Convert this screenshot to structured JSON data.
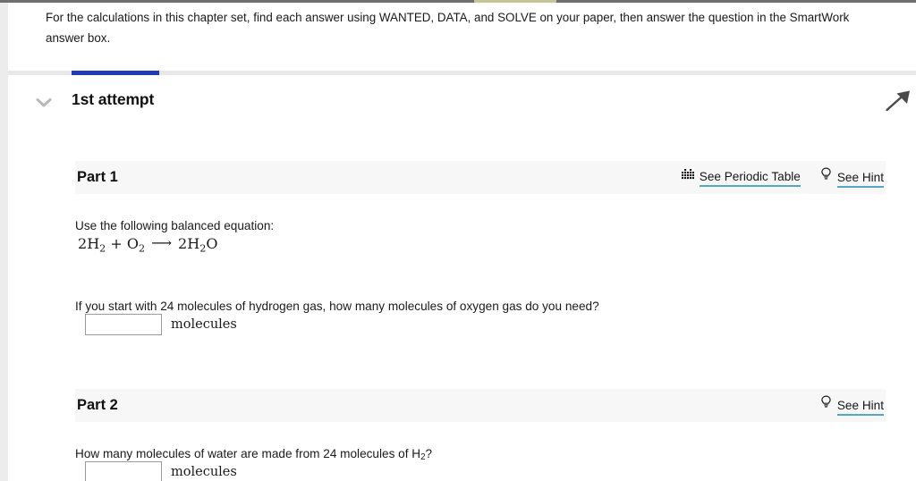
{
  "window": {
    "accent_blue": "#1f3cb4",
    "underline_teal": "#55a7c4",
    "band_bg": "#f7f7f7"
  },
  "intro": {
    "text": "For the calculations in this chapter set, find each answer using WANTED, DATA, and SOLVE on your paper, then answer the question in the SmartWork answer box."
  },
  "attempt": {
    "title": "1st attempt",
    "collapse_icon": "chevron-down-icon",
    "flag_icon": "flag-arrow-icon",
    "progress_percent": 9.7
  },
  "parts": [
    {
      "label": "Part 1",
      "actions": [
        {
          "label": "See Periodic Table",
          "icon": "periodic-table-icon"
        },
        {
          "label": "See Hint",
          "icon": "lightbulb-icon"
        }
      ],
      "prompt": "Use the following balanced equation:",
      "equation": {
        "lhs_coef_1": "2",
        "lhs_sym_1": "H",
        "lhs_sub_1": "2",
        "plus": "+",
        "lhs_sym_2": "O",
        "lhs_sub_2": "2",
        "arrow": "⟶",
        "rhs_coef": "2",
        "rhs_sym_1": "H",
        "rhs_sub_1": "2",
        "rhs_sym_2": "O",
        "plain": "2H2 + O2 ⟶ 2H2O"
      },
      "question": "If you start with 24 molecules of hydrogen gas, how many molecules of oxygen gas do you need?",
      "answer": {
        "value": "",
        "placeholder": "",
        "unit": "molecules"
      }
    },
    {
      "label": "Part 2",
      "actions": [
        {
          "label": "See Hint",
          "icon": "lightbulb-icon"
        }
      ],
      "question_pre": "How many molecules of water are made from 24 molecules of H",
      "question_sub": "2",
      "question_post": "?",
      "answer": {
        "value": "",
        "placeholder": "",
        "unit": "molecules"
      }
    }
  ]
}
